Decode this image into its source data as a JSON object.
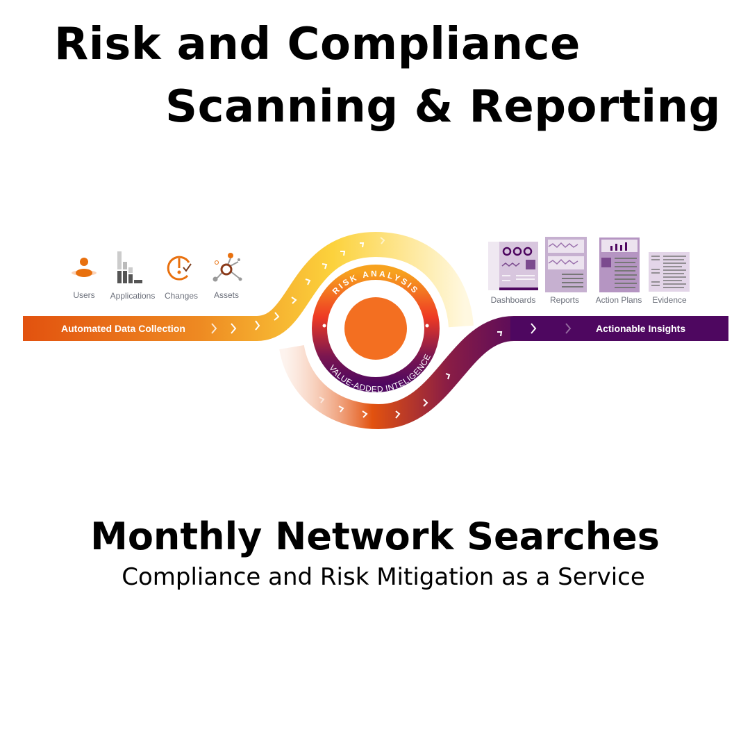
{
  "title": {
    "line1": "Risk and Compliance",
    "line2": "Scanning & Reporting"
  },
  "diagram": {
    "inputs": [
      {
        "label": "Users",
        "icon": "user-icon"
      },
      {
        "label": "Applications",
        "icon": "bar-blocks-icon"
      },
      {
        "label": "Changes",
        "icon": "clock-alert-check-icon"
      },
      {
        "label": "Assets",
        "icon": "network-node-icon"
      }
    ],
    "left_bar_label": "Automated Data Collection",
    "ring_top": "RISK ANALYSIS",
    "ring_bottom": "VALUE-ADDED INTELIGENCE",
    "right_bar_label": "Actionable Insights",
    "outputs": [
      {
        "label": "Dashboards",
        "icon": "dashboard-doc-icon"
      },
      {
        "label": "Reports",
        "icon": "report-doc-icon"
      },
      {
        "label": "Action Plans",
        "icon": "action-plan-doc-icon"
      },
      {
        "label": "Evidence",
        "icon": "evidence-doc-icon"
      }
    ],
    "colors": {
      "orange": "#e2520f",
      "yellow": "#fcd23c",
      "purple": "#4e0760",
      "lavender": "#c9b3d2"
    }
  },
  "footer": {
    "heading": "Monthly Network Searches",
    "subheading": "Compliance and Risk Mitigation as a Service"
  }
}
